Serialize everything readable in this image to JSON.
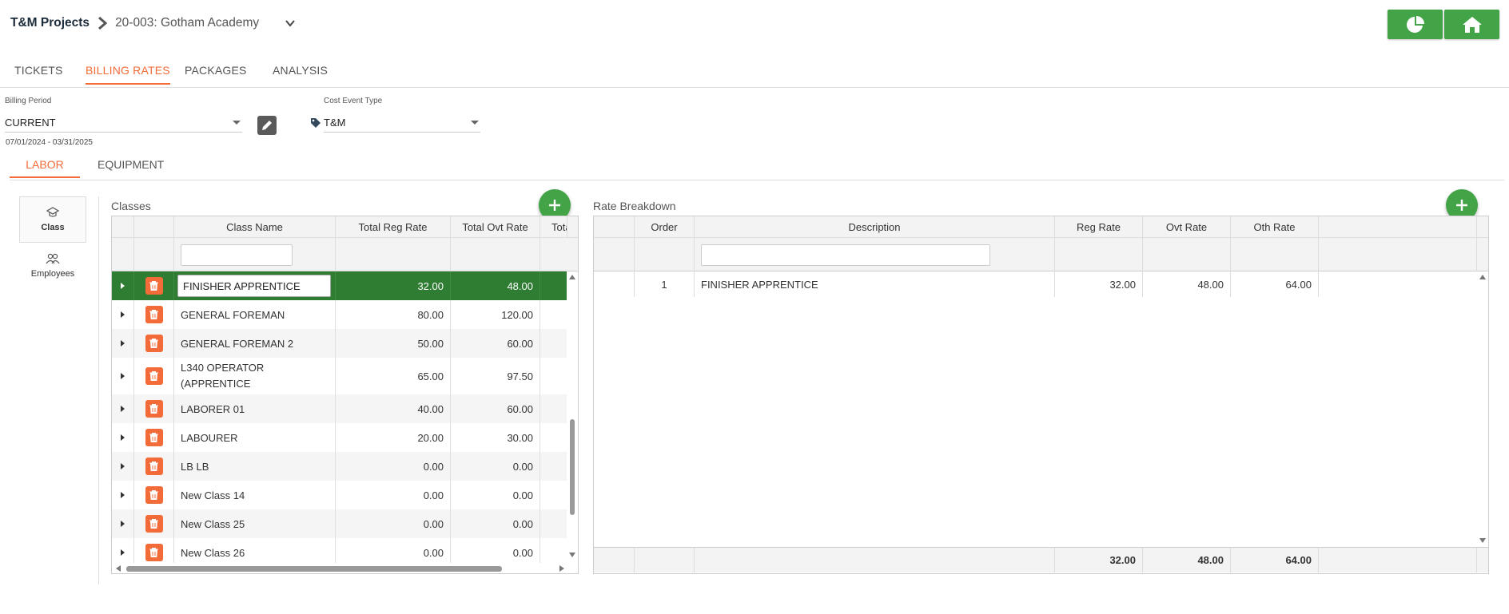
{
  "breadcrumb": {
    "root": "T&M Projects",
    "current": "20-003: Gotham Academy"
  },
  "header_buttons": [
    {
      "name": "dashboard",
      "icon": "pie-chart-icon"
    },
    {
      "name": "home",
      "icon": "home-icon"
    }
  ],
  "tabs": [
    {
      "label": "TICKETS",
      "active": false
    },
    {
      "label": "BILLING RATES",
      "active": true
    },
    {
      "label": "PACKAGES",
      "active": false
    },
    {
      "label": "ANALYSIS",
      "active": false
    }
  ],
  "filters": {
    "billing_period": {
      "label": "Billing Period",
      "value": "CURRENT",
      "range": "07/01/2024 - 03/31/2025"
    },
    "cost_event_type": {
      "label": "Cost Event Type",
      "value": "T&M",
      "icon": "tag-icon"
    }
  },
  "sub_tabs": [
    {
      "label": "LABOR",
      "active": true
    },
    {
      "label": "EQUIPMENT",
      "active": false
    }
  ],
  "side_nav": [
    {
      "label": "Class",
      "icon": "graduation-cap-icon",
      "active": true
    },
    {
      "label": "Employees",
      "icon": "users-icon",
      "active": false
    }
  ],
  "classes": {
    "title": "Classes",
    "columns": [
      "",
      "",
      "Class Name",
      "Total Reg Rate",
      "Total Ovt Rate",
      "Tota"
    ],
    "rows": [
      {
        "name": "FINISHER APPRENTICE",
        "reg": "32.00",
        "ovt": "48.00",
        "selected": true
      },
      {
        "name": "GENERAL FOREMAN",
        "reg": "80.00",
        "ovt": "120.00"
      },
      {
        "name": "GENERAL FOREMAN 2",
        "reg": "50.00",
        "ovt": "60.00"
      },
      {
        "name": "L340 OPERATOR (APPRENTICE",
        "reg": "65.00",
        "ovt": "97.50"
      },
      {
        "name": "LABORER 01",
        "reg": "40.00",
        "ovt": "60.00"
      },
      {
        "name": "LABOURER",
        "reg": "20.00",
        "ovt": "30.00"
      },
      {
        "name": "LB LB",
        "reg": "0.00",
        "ovt": "0.00"
      },
      {
        "name": "New Class 14",
        "reg": "0.00",
        "ovt": "0.00"
      },
      {
        "name": "New Class 25",
        "reg": "0.00",
        "ovt": "0.00"
      },
      {
        "name": "New Class 26",
        "reg": "0.00",
        "ovt": "0.00"
      }
    ]
  },
  "rate_breakdown": {
    "title": "Rate Breakdown",
    "columns": [
      "",
      "Order",
      "Description",
      "Reg Rate",
      "Ovt Rate",
      "Oth Rate",
      ""
    ],
    "rows": [
      {
        "order": "1",
        "description": "FINISHER APPRENTICE",
        "reg": "32.00",
        "ovt": "48.00",
        "oth": "64.00"
      }
    ],
    "totals": {
      "reg": "32.00",
      "ovt": "48.00",
      "oth": "64.00"
    }
  },
  "colors": {
    "accent": "#f26b38",
    "green": "#43a447",
    "selected_row": "#2e7d32"
  }
}
